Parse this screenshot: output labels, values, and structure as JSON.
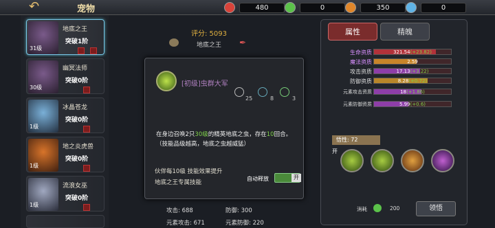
{
  "header": {
    "title": "宠物"
  },
  "resources": [
    {
      "icon": "red-gem-icon",
      "value": "480",
      "color": "#d8433a"
    },
    {
      "icon": "green-gem-icon",
      "value": "0",
      "color": "#5bc24a"
    },
    {
      "icon": "orange-lightning-icon",
      "value": "350",
      "color": "#e0862a"
    },
    {
      "icon": "blue-snowflake-icon",
      "value": "0",
      "color": "#5fb3e6"
    }
  ],
  "pets": [
    {
      "name": "地底之王",
      "breakthrough": "突破1阶",
      "level": "31级",
      "selected": true
    },
    {
      "name": "幽冥法师",
      "breakthrough": "突破0阶",
      "level": "30级",
      "selected": false
    },
    {
      "name": "冰晶苍龙",
      "breakthrough": "突破0阶",
      "level": "1级",
      "selected": false
    },
    {
      "name": "地之炎虎兽",
      "breakthrough": "突破0阶",
      "level": "1级",
      "selected": false
    },
    {
      "name": "流浪女巫",
      "breakthrough": "突破0阶",
      "level": "1级",
      "selected": false
    }
  ],
  "center": {
    "score": "评分: 5093",
    "pet_name": "地底之王"
  },
  "popup": {
    "skill_name": "[初级]虫群大军",
    "stats": [
      "25",
      "8",
      "3"
    ],
    "desc_1a": "在身边召唤2只",
    "desc_1b": "30级",
    "desc_1c": "的精英地底之虫，存在",
    "desc_1d": "10",
    "desc_1e": "回合。",
    "desc_2": "（技能品级越高，地底之虫越威猛）",
    "bonus_1": "伙伴每10级 技能效果提升",
    "bonus_2": "地底之王专属技能",
    "auto_label": "自动释放",
    "toggle_label": "开"
  },
  "bottom_stats": {
    "attack": "攻击: 688",
    "defense": "防御: 300",
    "elem_attack": "元素攻击: 671",
    "elem_defense": "元素防御: 220"
  },
  "right": {
    "tab_attr": "属性",
    "tab_soul": "精魄",
    "attributes": [
      {
        "label": "生命资质",
        "value": "321.54",
        "bonus": "(+23.82)",
        "fill": 0.8,
        "color": "#b2323a",
        "special": true
      },
      {
        "label": "魔法资质",
        "value": "2.59",
        "bonus": "",
        "fill": 0.55,
        "color": "#c8842a",
        "special": true
      },
      {
        "label": "攻击资质",
        "value": "17.13",
        "bonus": "(+3.22)",
        "fill": 0.6,
        "color": "#8e3ea8",
        "special": false
      },
      {
        "label": "防御资质",
        "value": "8.28",
        "bonus": "(+0.72)",
        "fill": 0.7,
        "color": "#b8862a",
        "special": false
      },
      {
        "label": "元素攻击资质",
        "value": "18",
        "bonus": "(+1.86)",
        "fill": 0.62,
        "color": "#8e3ea8",
        "special": false
      },
      {
        "label": "元素防御资质",
        "value": "5.99",
        "bonus": "(+0.6)",
        "fill": 0.45,
        "color": "#8e3ea8",
        "special": false
      }
    ],
    "wuxing": "悟性: 72",
    "skill_tag": "开",
    "cost_label": "消耗",
    "cost_value": "200",
    "lingwu": "领悟"
  }
}
